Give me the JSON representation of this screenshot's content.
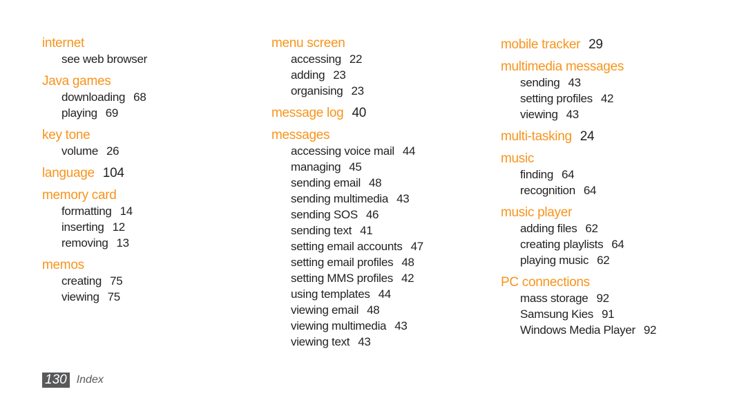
{
  "accent_color": "#f7941d",
  "columns": [
    {
      "entries": [
        {
          "term": "internet",
          "subs": [
            {
              "term": "see web browser"
            }
          ]
        },
        {
          "term": "Java games",
          "subs": [
            {
              "term": "downloading",
              "page": "68"
            },
            {
              "term": "playing",
              "page": "69"
            }
          ]
        },
        {
          "term": "key tone",
          "subs": [
            {
              "term": "volume",
              "page": "26"
            }
          ]
        },
        {
          "term": "language",
          "page": "104",
          "subs": []
        },
        {
          "term": "memory card",
          "subs": [
            {
              "term": "formatting",
              "page": "14"
            },
            {
              "term": "inserting",
              "page": "12"
            },
            {
              "term": "removing",
              "page": "13"
            }
          ]
        },
        {
          "term": "memos",
          "subs": [
            {
              "term": "creating",
              "page": "75"
            },
            {
              "term": "viewing",
              "page": "75"
            }
          ]
        }
      ]
    },
    {
      "entries": [
        {
          "term": "menu screen",
          "subs": [
            {
              "term": "accessing",
              "page": "22"
            },
            {
              "term": "adding",
              "page": "23"
            },
            {
              "term": "organising",
              "page": "23"
            }
          ]
        },
        {
          "term": "message log",
          "page": "40",
          "subs": []
        },
        {
          "term": "messages",
          "subs": [
            {
              "term": "accessing voice mail",
              "page": "44"
            },
            {
              "term": "managing",
              "page": "45"
            },
            {
              "term": "sending email",
              "page": "48"
            },
            {
              "term": "sending multimedia",
              "page": "43"
            },
            {
              "term": "sending SOS",
              "page": "46"
            },
            {
              "term": "sending text",
              "page": "41"
            },
            {
              "term": "setting email accounts",
              "page": "47"
            },
            {
              "term": "setting email profiles",
              "page": "48"
            },
            {
              "term": "setting MMS profiles",
              "page": "42"
            },
            {
              "term": "using templates",
              "page": "44"
            },
            {
              "term": "viewing email",
              "page": "48"
            },
            {
              "term": "viewing multimedia",
              "page": "43"
            },
            {
              "term": "viewing text",
              "page": "43"
            }
          ]
        }
      ]
    },
    {
      "entries": [
        {
          "term": "mobile tracker",
          "page": "29",
          "subs": []
        },
        {
          "term": "multimedia messages",
          "subs": [
            {
              "term": "sending",
              "page": "43"
            },
            {
              "term": "setting profiles",
              "page": "42"
            },
            {
              "term": "viewing",
              "page": "43"
            }
          ]
        },
        {
          "term": "multi-tasking",
          "page": "24",
          "subs": []
        },
        {
          "term": "music",
          "subs": [
            {
              "term": "finding",
              "page": "64"
            },
            {
              "term": "recognition",
              "page": "64"
            }
          ]
        },
        {
          "term": "music player",
          "subs": [
            {
              "term": "adding files",
              "page": "62"
            },
            {
              "term": "creating playlists",
              "page": "64"
            },
            {
              "term": "playing music",
              "page": "62"
            }
          ]
        },
        {
          "term": "PC connections",
          "subs": [
            {
              "term": "mass storage",
              "page": "92"
            },
            {
              "term": "Samsung Kies",
              "page": "91"
            },
            {
              "term": "Windows Media Player",
              "page": "92"
            }
          ]
        }
      ]
    }
  ],
  "footer": {
    "page_number": "130",
    "section": "Index"
  }
}
